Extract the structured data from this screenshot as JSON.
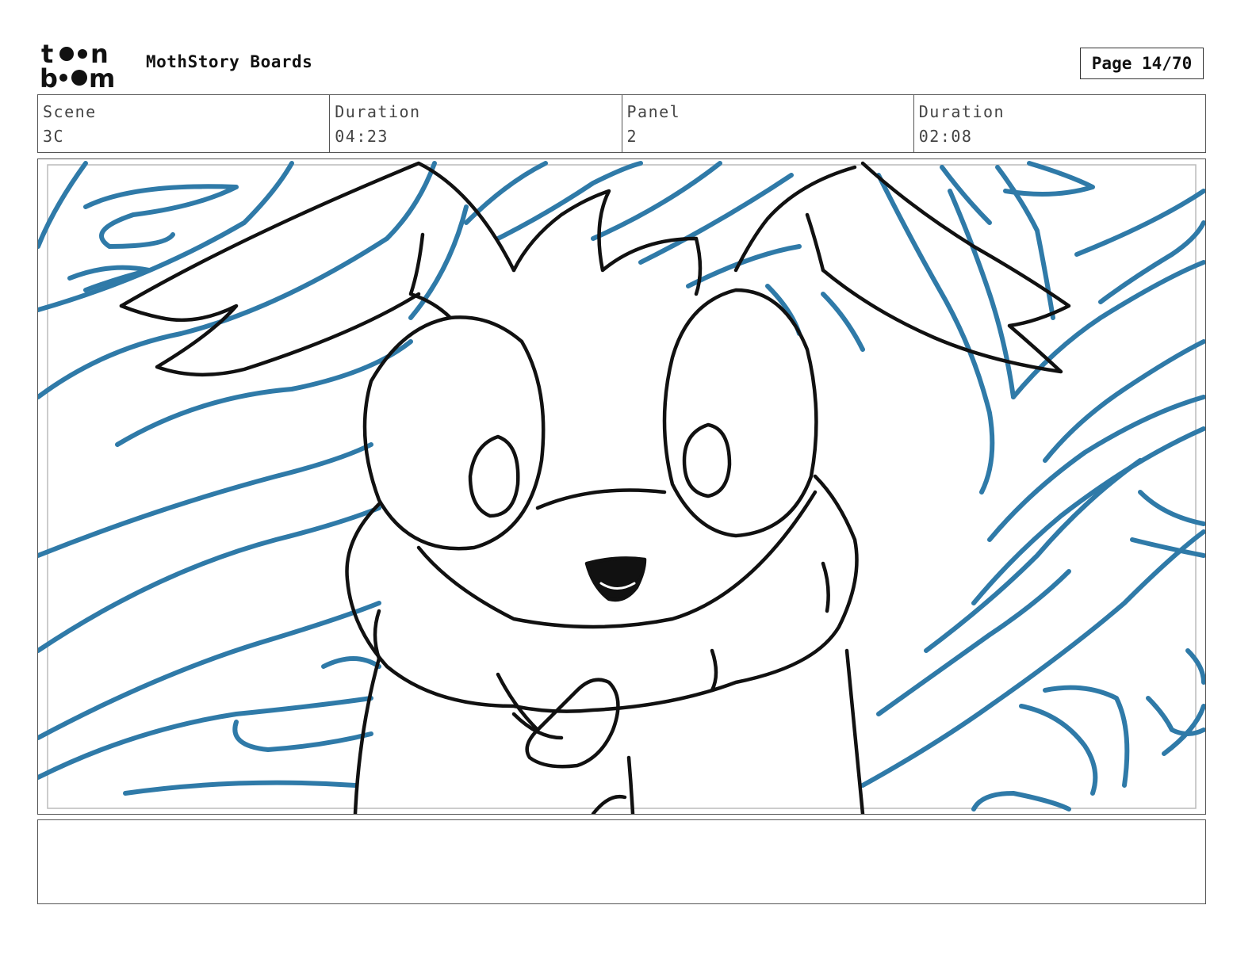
{
  "header": {
    "logo_text": "toonboom",
    "title": "MothStory Boards",
    "page_label": "Page 14/70"
  },
  "meta": [
    {
      "label": "Scene",
      "value": "3C"
    },
    {
      "label": "Duration",
      "value": "04:23"
    },
    {
      "label": "Panel",
      "value": "2"
    },
    {
      "label": "Duration",
      "value": "02:08"
    }
  ],
  "panel": {
    "line_color": "#111111",
    "background_line_color": "#2f7aa8"
  },
  "notes": {
    "text": ""
  }
}
